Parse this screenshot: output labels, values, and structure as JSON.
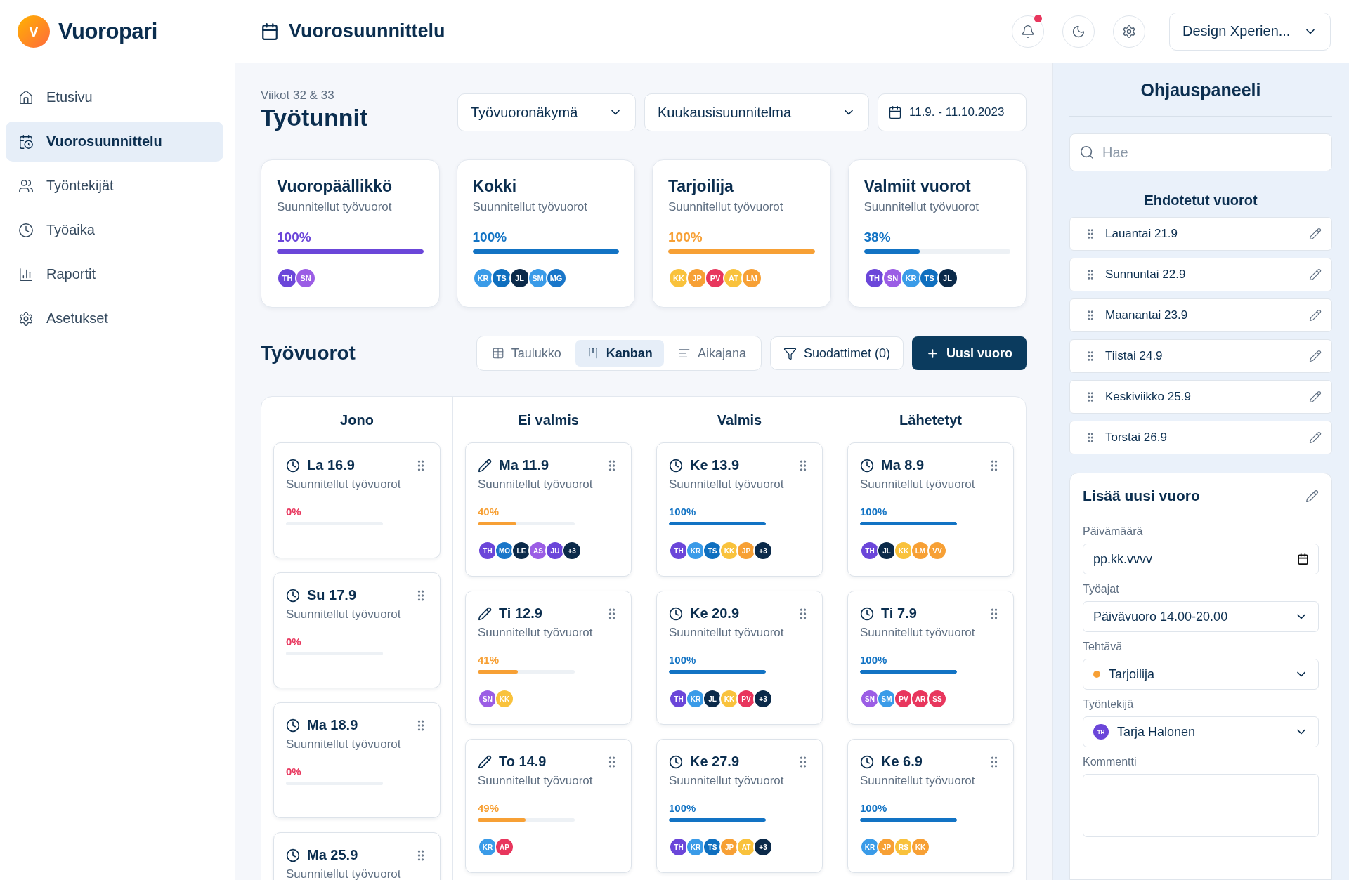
{
  "app": {
    "logo_letter": "V",
    "name": "Vuoropari"
  },
  "sidebar": {
    "items": [
      {
        "label": "Etusivu",
        "selected": false
      },
      {
        "label": "Vuorosuunnittelu",
        "selected": true
      },
      {
        "label": "Työntekijät",
        "selected": false
      },
      {
        "label": "Työaika",
        "selected": false
      },
      {
        "label": "Raportit",
        "selected": false
      },
      {
        "label": "Asetukset",
        "selected": false
      }
    ]
  },
  "header": {
    "title": "Vuorosuunnittelu",
    "notifications_unread": true,
    "workspace": "Design Xperien..."
  },
  "page": {
    "subtitle": "Viikot 32 & 33",
    "title": "Työtunnit",
    "view_select": "Työvuoronäkymä",
    "plan_select": "Kuukausisuunnitelma",
    "date_range": "11.9. - 11.10.2023"
  },
  "summary": [
    {
      "title": "Vuoropäällikkö",
      "subtitle": "Suunnitellut työvuorot",
      "percent": "100%",
      "level": 1,
      "color": "#6b46d9",
      "avatars": [
        {
          "initials": "TH",
          "color": "#6b46d9"
        },
        {
          "initials": "SN",
          "color": "#9b5de5"
        }
      ]
    },
    {
      "title": "Kokki",
      "subtitle": "Suunnitellut työvuorot",
      "percent": "100%",
      "level": 1,
      "color": "#1273c4",
      "avatars": [
        {
          "initials": "KR",
          "color": "#3a9be8"
        },
        {
          "initials": "TS",
          "color": "#0f6fbf"
        },
        {
          "initials": "JL",
          "color": "#0b2a4a"
        },
        {
          "initials": "SM",
          "color": "#3a9be8"
        },
        {
          "initials": "MG",
          "color": "#1976c9"
        }
      ]
    },
    {
      "title": "Tarjoilija",
      "subtitle": "Suunnitellut työvuorot",
      "percent": "100%",
      "level": 1,
      "color": "#f7a035",
      "avatars": [
        {
          "initials": "KK",
          "color": "#f9c23c"
        },
        {
          "initials": "JP",
          "color": "#f7a035"
        },
        {
          "initials": "PV",
          "color": "#e8365d"
        },
        {
          "initials": "AT",
          "color": "#f9c23c"
        },
        {
          "initials": "LM",
          "color": "#f7a035"
        }
      ]
    },
    {
      "title": "Valmiit vuorot",
      "subtitle": "Suunnitellut työvuorot",
      "percent": "38%",
      "level": 0.38,
      "color": "#1273c4",
      "avatars": [
        {
          "initials": "TH",
          "color": "#6b46d9"
        },
        {
          "initials": "SN",
          "color": "#9b5de5"
        },
        {
          "initials": "KR",
          "color": "#3a9be8"
        },
        {
          "initials": "TS",
          "color": "#0f6fbf"
        },
        {
          "initials": "JL",
          "color": "#0b2a4a"
        }
      ]
    }
  ],
  "shifts": {
    "title": "Työvuorot",
    "views": [
      {
        "label": "Taulukko",
        "selected": false
      },
      {
        "label": "Kanban",
        "selected": true
      },
      {
        "label": "Aikajana",
        "selected": false
      }
    ],
    "filters": "Suodattimet (0)",
    "new_button": "Uusi vuoro"
  },
  "kanban": [
    {
      "title": "Jono",
      "cards": [
        {
          "kind": "scheduled",
          "date": "La 16.9",
          "subtitle": "Suunnitellut työvuorot",
          "percent": "0%",
          "color": "#e8365d"
        },
        {
          "kind": "scheduled",
          "date": "Su 17.9",
          "subtitle": "Suunnitellut työvuorot",
          "percent": "0%",
          "color": "#e8365d"
        },
        {
          "kind": "scheduled",
          "date": "Ma 18.9",
          "subtitle": "Suunnitellut työvuorot",
          "percent": "0%",
          "color": "#e8365d"
        },
        {
          "kind": "scheduled",
          "date": "Ma 25.9",
          "subtitle": "Suunnitellut työvuorot"
        }
      ]
    },
    {
      "title": "Ei valmis",
      "cards": [
        {
          "kind": "draft",
          "date": "Ma 11.9",
          "subtitle": "Suunnitellut työvuorot",
          "percent": "40%",
          "level": 0.4,
          "color": "#f7a035",
          "avatars": [
            {
              "initials": "TH",
              "color": "#6b46d9"
            },
            {
              "initials": "MO",
              "color": "#1976c9"
            },
            {
              "initials": "LE",
              "color": "#0b2a4a"
            },
            {
              "initials": "AS",
              "color": "#9b5de5"
            },
            {
              "initials": "JU",
              "color": "#6b46d9"
            },
            {
              "initials": "+3",
              "color": "#0b2a4a"
            }
          ]
        },
        {
          "kind": "draft",
          "date": "Ti 12.9",
          "subtitle": "Suunnitellut työvuorot",
          "percent": "41%",
          "level": 0.41,
          "color": "#f7a035",
          "avatars": [
            {
              "initials": "SN",
              "color": "#9b5de5"
            },
            {
              "initials": "KK",
              "color": "#f9c23c"
            }
          ]
        },
        {
          "kind": "draft",
          "date": "To 14.9",
          "subtitle": "Suunnitellut työvuorot",
          "percent": "49%",
          "level": 0.49,
          "color": "#f7a035",
          "avatars": [
            {
              "initials": "KR",
              "color": "#3a9be8"
            },
            {
              "initials": "AP",
              "color": "#e8365d"
            }
          ]
        }
      ]
    },
    {
      "title": "Valmis",
      "cards": [
        {
          "kind": "scheduled",
          "date": "Ke 13.9",
          "subtitle": "Suunnitellut työvuorot",
          "percent": "100%",
          "level": 1,
          "color": "#1273c4",
          "avatars": [
            {
              "initials": "TH",
              "color": "#6b46d9"
            },
            {
              "initials": "KR",
              "color": "#3a9be8"
            },
            {
              "initials": "TS",
              "color": "#0f6fbf"
            },
            {
              "initials": "KK",
              "color": "#f9c23c"
            },
            {
              "initials": "JP",
              "color": "#f7a035"
            },
            {
              "initials": "+3",
              "color": "#0b2a4a"
            }
          ]
        },
        {
          "kind": "scheduled",
          "date": "Ke 20.9",
          "subtitle": "Suunnitellut työvuorot",
          "percent": "100%",
          "level": 1,
          "color": "#1273c4",
          "avatars": [
            {
              "initials": "TH",
              "color": "#6b46d9"
            },
            {
              "initials": "KR",
              "color": "#3a9be8"
            },
            {
              "initials": "JL",
              "color": "#0b2a4a"
            },
            {
              "initials": "KK",
              "color": "#f9c23c"
            },
            {
              "initials": "PV",
              "color": "#e8365d"
            },
            {
              "initials": "+3",
              "color": "#0b2a4a"
            }
          ]
        },
        {
          "kind": "scheduled",
          "date": "Ke 27.9",
          "subtitle": "Suunnitellut työvuorot",
          "percent": "100%",
          "level": 1,
          "color": "#1273c4",
          "avatars": [
            {
              "initials": "TH",
              "color": "#6b46d9"
            },
            {
              "initials": "KR",
              "color": "#3a9be8"
            },
            {
              "initials": "TS",
              "color": "#0f6fbf"
            },
            {
              "initials": "JP",
              "color": "#f7a035"
            },
            {
              "initials": "AT",
              "color": "#f9c23c"
            },
            {
              "initials": "+3",
              "color": "#0b2a4a"
            }
          ]
        }
      ]
    },
    {
      "title": "Lähetetyt",
      "cards": [
        {
          "kind": "scheduled",
          "date": "Ma 8.9",
          "subtitle": "Suunnitellut työvuorot",
          "percent": "100%",
          "level": 1,
          "color": "#1273c4",
          "avatars": [
            {
              "initials": "TH",
              "color": "#6b46d9"
            },
            {
              "initials": "JL",
              "color": "#0b2a4a"
            },
            {
              "initials": "KK",
              "color": "#f9c23c"
            },
            {
              "initials": "LM",
              "color": "#f7a035"
            },
            {
              "initials": "VV",
              "color": "#f7a035"
            }
          ]
        },
        {
          "kind": "scheduled",
          "date": "Ti 7.9",
          "subtitle": "Suunnitellut työvuorot",
          "percent": "100%",
          "level": 1,
          "color": "#1273c4",
          "avatars": [
            {
              "initials": "SN",
              "color": "#9b5de5"
            },
            {
              "initials": "SM",
              "color": "#3a9be8"
            },
            {
              "initials": "PV",
              "color": "#e8365d"
            },
            {
              "initials": "AR",
              "color": "#e8365d"
            },
            {
              "initials": "SS",
              "color": "#e8365d"
            }
          ]
        },
        {
          "kind": "scheduled",
          "date": "Ke 6.9",
          "subtitle": "Suunnitellut työvuorot",
          "percent": "100%",
          "level": 1,
          "color": "#1273c4",
          "avatars": [
            {
              "initials": "KR",
              "color": "#3a9be8"
            },
            {
              "initials": "JP",
              "color": "#f7a035"
            },
            {
              "initials": "RS",
              "color": "#f9c23c"
            },
            {
              "initials": "KK",
              "color": "#f7a035"
            }
          ]
        }
      ]
    }
  ],
  "panel": {
    "title": "Ohjauspaneeli",
    "search_placeholder": "Hae",
    "suggested_title": "Ehdotetut vuorot",
    "suggested": [
      "Lauantai 21.9",
      "Sunnuntai 22.9",
      "Maanantai 23.9",
      "Tiistai 24.9",
      "Keskiviikko 25.9",
      "Torstai 26.9"
    ],
    "form": {
      "title": "Lisää uusi vuoro",
      "date": {
        "label": "Päivämäärä",
        "placeholder": "pp.kk.vvvv"
      },
      "hours": {
        "label": "Työajat",
        "value": "Päivävuoro 14.00-20.00"
      },
      "task": {
        "label": "Tehtävä",
        "value": "Tarjoilija",
        "color": "#f7a035"
      },
      "employee": {
        "label": "Työntekijä",
        "value": "Tarja Halonen",
        "initials": "TH",
        "color": "#6b46d9"
      },
      "comment": {
        "label": "Kommentti"
      }
    }
  }
}
